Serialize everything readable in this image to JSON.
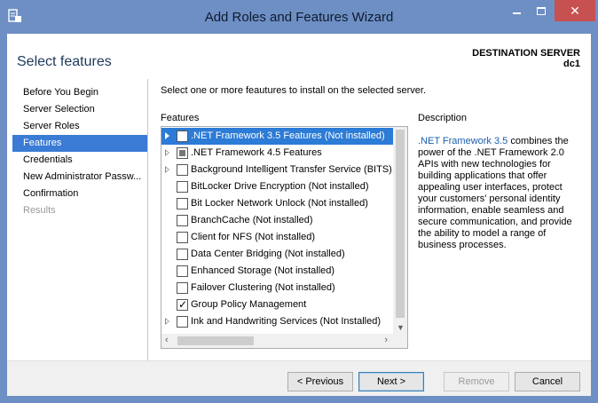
{
  "window": {
    "title": "Add Roles and Features Wizard",
    "close_glyph": "✕"
  },
  "header": {
    "page_title": "Select features",
    "destination_label": "DESTINATION SERVER",
    "destination_name": "dc1"
  },
  "nav": {
    "items": [
      {
        "label": "Before You Begin"
      },
      {
        "label": "Server Selection"
      },
      {
        "label": "Server Roles"
      },
      {
        "label": "Features"
      },
      {
        "label": "Credentials"
      },
      {
        "label": "New Administrator Passw..."
      },
      {
        "label": "Confirmation"
      },
      {
        "label": "Results"
      }
    ],
    "selected_index": 3
  },
  "main": {
    "instruction": "Select one or more feautures to install on the selected server.",
    "features_heading": "Features",
    "description_heading": "Description",
    "features": [
      {
        "label": ".NET Framework 3.5 Features (Not installed)"
      },
      {
        "label": ".NET Framework 4.5 Features"
      },
      {
        "label": "Background Intelligent Transfer Service (BITS)..."
      },
      {
        "label": "BitLocker Drive Encryption (Not installed)"
      },
      {
        "label": "Bit Locker Network Unlock (Not installed)"
      },
      {
        "label": "BranchCache (Not installed)"
      },
      {
        "label": "Client for NFS (Not installed)"
      },
      {
        "label": "Data Center Bridging (Not installed)"
      },
      {
        "label": "Enhanced Storage (Not installed)"
      },
      {
        "label": "Failover Clustering (Not installed)"
      },
      {
        "label": "Group Policy Management"
      },
      {
        "label": "Ink and Handwriting Services (Not Installed)"
      }
    ],
    "description_link": ".NET Framework 3.5",
    "description_text": " combines the power of the .NET Framework 2.0 APIs with new technologies for building applications that offer appealing user interfaces, protect your customers' personal identity information, enable seamless and secure communication, and provide the ability to model a range of business processes."
  },
  "footer": {
    "previous_label": "< Previous",
    "next_label": "Next >",
    "remove_label": "Remove",
    "cancel_label": "Cancel"
  },
  "colors": {
    "title_bar": "#6e8fc4",
    "selection": "#3a7bd5",
    "close_button": "#c75050",
    "link": "#1a5eab"
  }
}
